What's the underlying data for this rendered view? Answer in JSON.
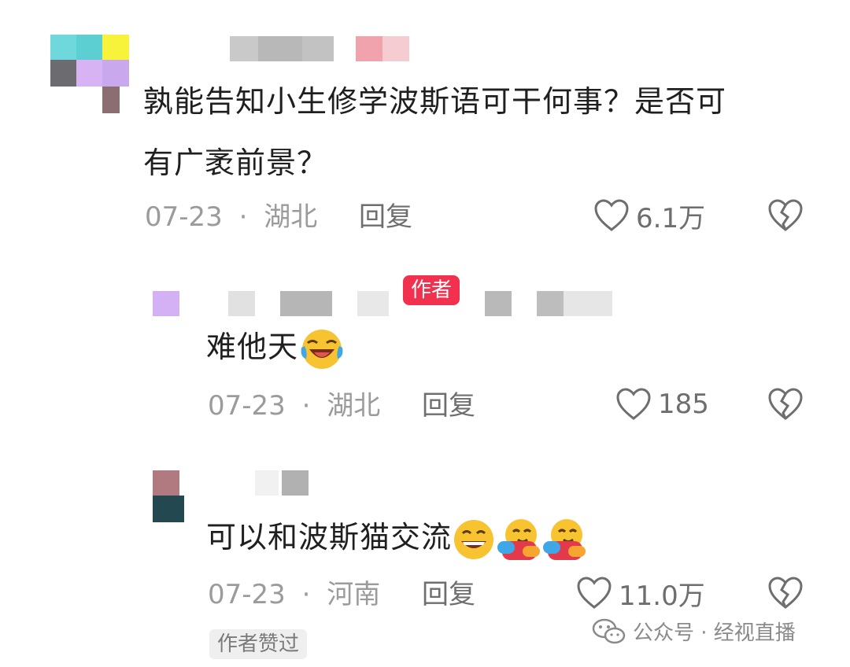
{
  "comments": [
    {
      "text_line1": "孰能告知小生修学波斯语可干何事？是否可",
      "text_line2": "有广袤前景？",
      "date": "07-23",
      "sep": "·",
      "location": "湖北",
      "reply_label": "回复",
      "likes": "6.1万"
    },
    {
      "badge": "作者",
      "text": "难他天",
      "emoji": "rolling-laugh-emoji",
      "date": "07-23",
      "sep": "·",
      "location": "湖北",
      "reply_label": "回复",
      "likes": "185"
    },
    {
      "text": "可以和波斯猫交流",
      "emojis": [
        "grin-emoji",
        "hug-emoji",
        "hug-emoji"
      ],
      "date": "07-23",
      "sep": "·",
      "location": "河南",
      "reply_label": "回复",
      "likes": "11.0万",
      "liked_by_author": "作者赞过"
    }
  ],
  "watermark": {
    "icon": "wechat-icon",
    "text": "公众号 · 经视直播"
  },
  "colors": {
    "author_badge": "#f2314f",
    "meta_text": "#9b9b9b",
    "icon_gray": "#6e6e6e"
  }
}
